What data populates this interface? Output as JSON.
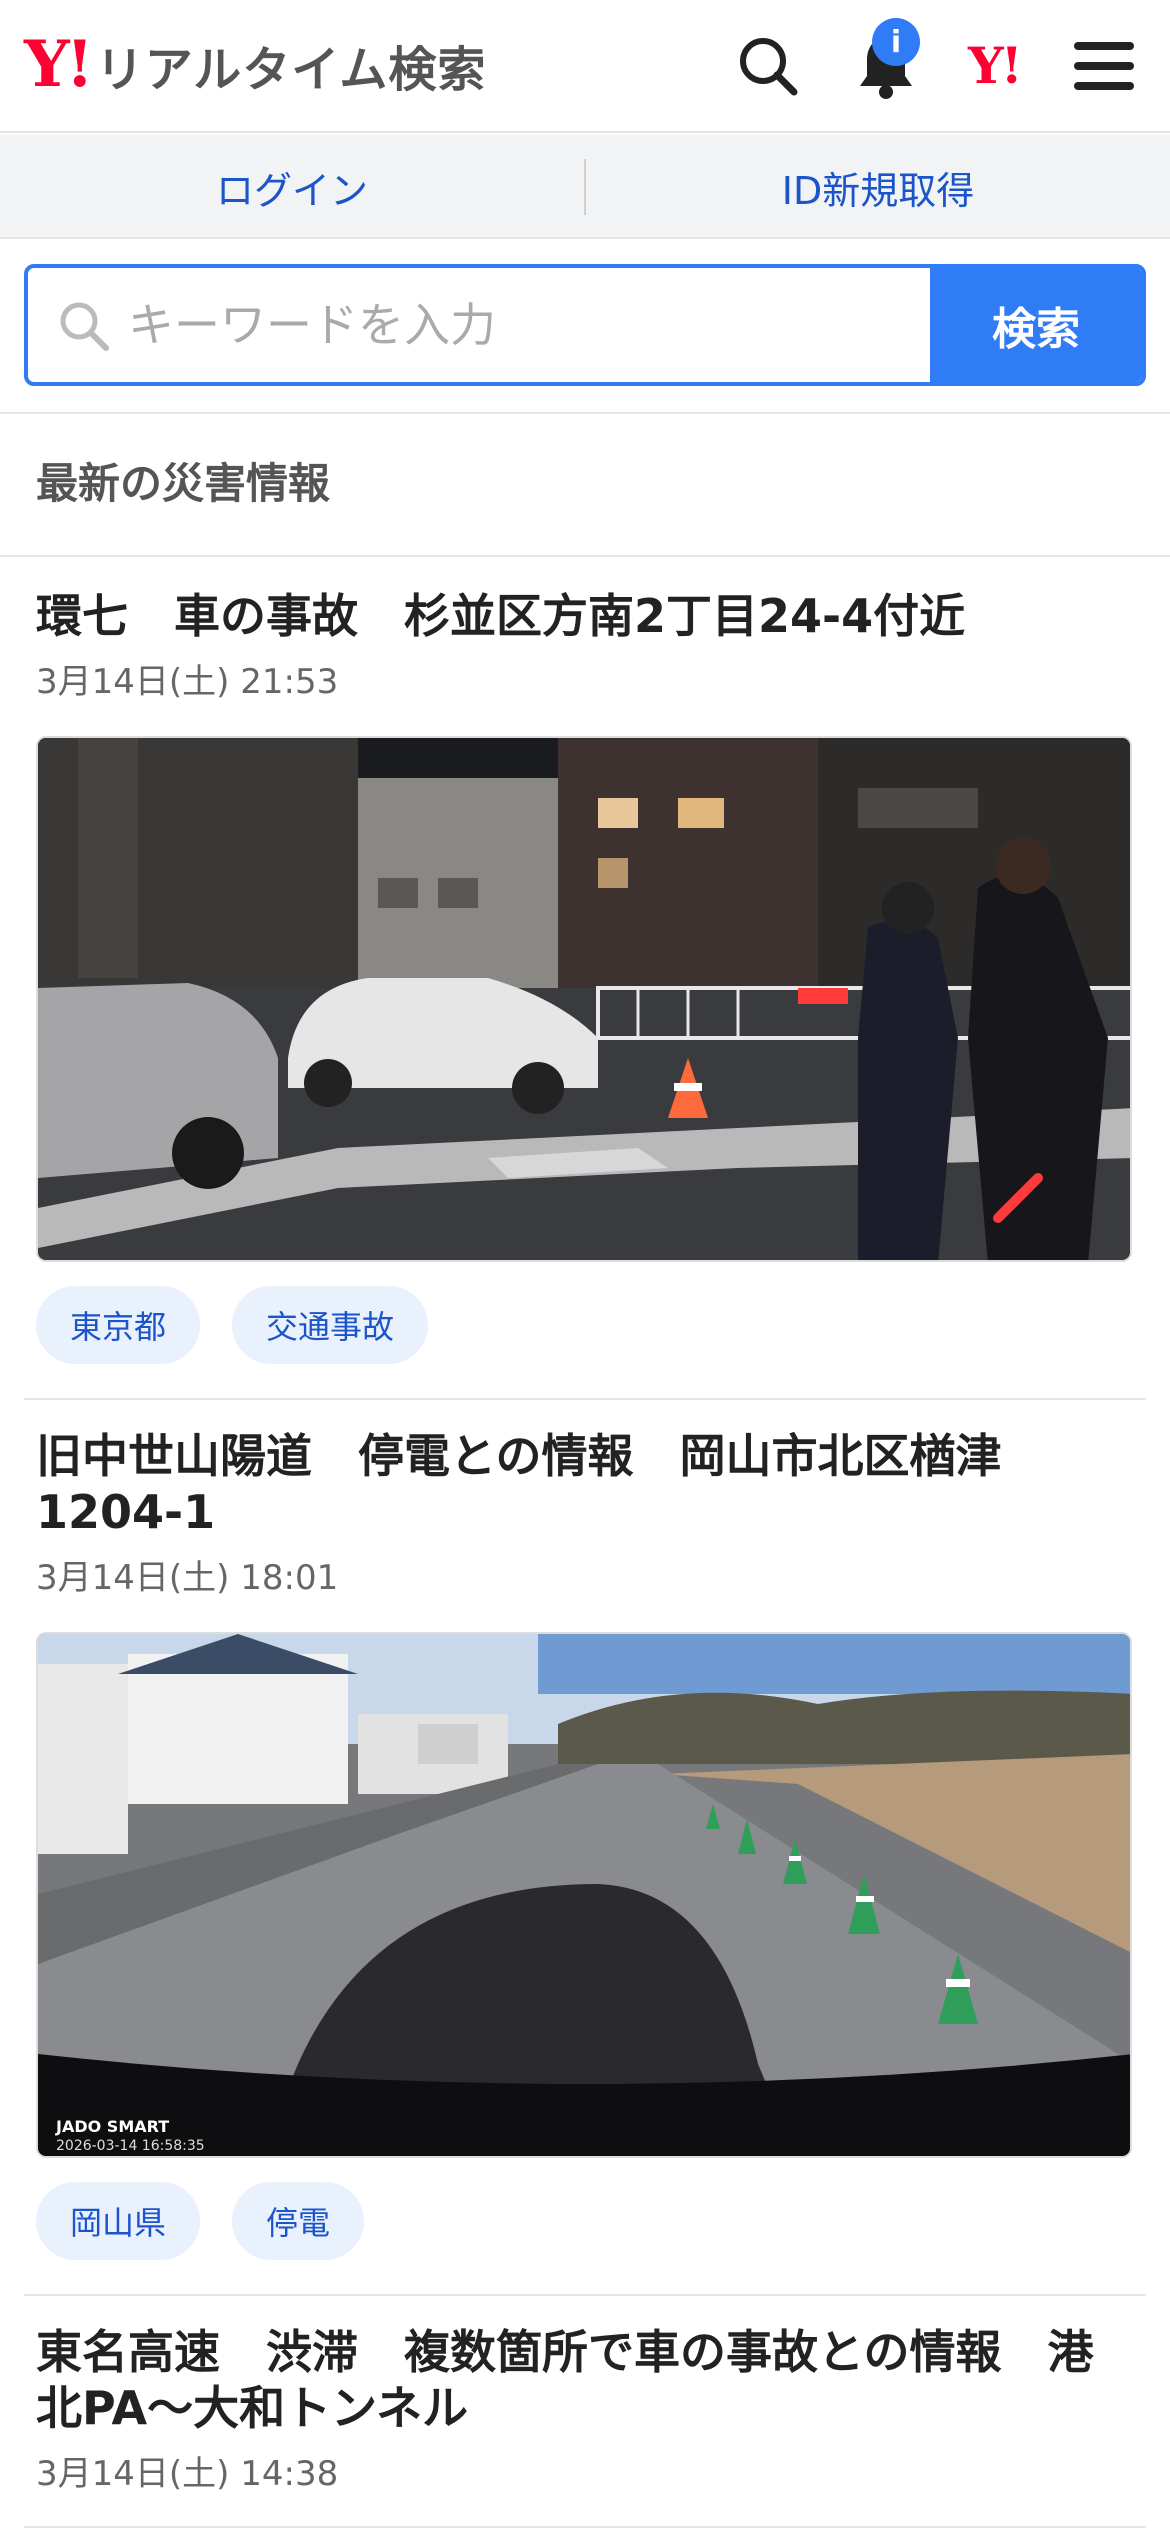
{
  "header": {
    "logo_mark": "Y!",
    "logo_text": "リアルタイム検索",
    "notification_badge": "i",
    "yahoo_mark": "Y!"
  },
  "loginbar": {
    "login_label": "ログイン",
    "register_label": "ID新規取得"
  },
  "search": {
    "placeholder": "キーワードを入力",
    "button_label": "検索"
  },
  "section": {
    "title": "最新の災害情報"
  },
  "articles": [
    {
      "title": "環七　車の事故　杉並区方南2丁目24-4付近",
      "date": "3月14日(土) 21:53",
      "tags": [
        "東京都",
        "交通事故"
      ]
    },
    {
      "title": "旧中世山陽道　停電との情報　岡山市北区楢津1204-1",
      "date": "3月14日(土) 18:01",
      "tags": [
        "岡山県",
        "停電"
      ],
      "photo_caption": "JADO SMART",
      "photo_timestamp": "2026-03-14  16:58:35"
    },
    {
      "title": "東名高速　渋滞　複数箇所で車の事故との情報　港北PA～大和トンネル",
      "date": "3月14日(土) 14:38"
    }
  ],
  "colors": {
    "brand_red": "#ff0033",
    "accent_blue": "#2f7cf6",
    "link_blue": "#1b55c9",
    "tag_bg": "#e9f1fd"
  }
}
